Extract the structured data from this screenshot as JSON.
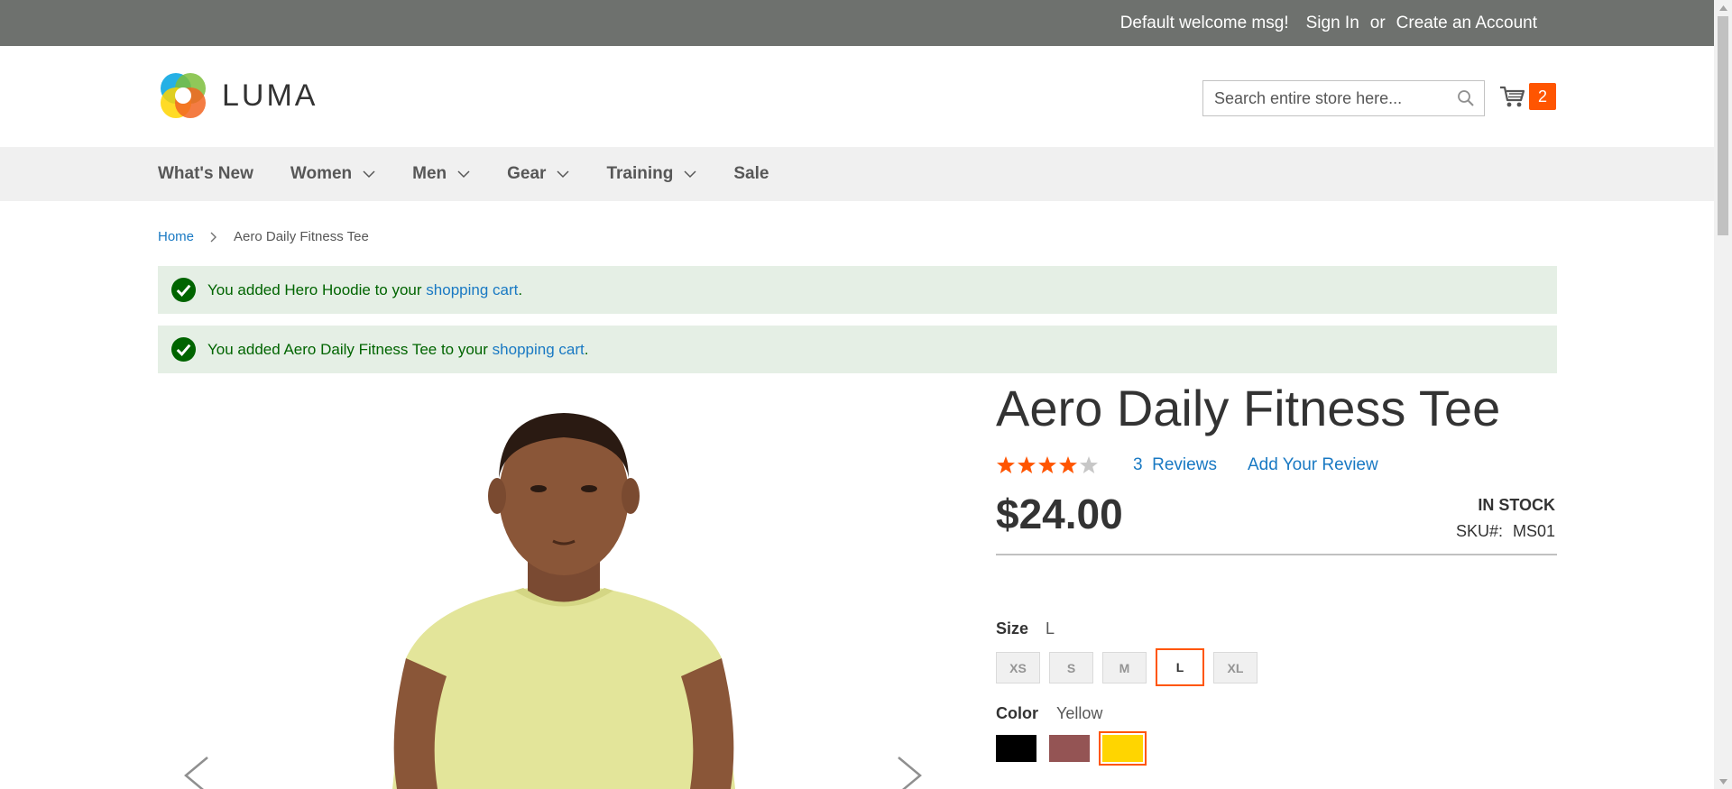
{
  "top_panel": {
    "welcome": "Default welcome msg!",
    "sign_in": "Sign In",
    "or": "or",
    "create_account": "Create an Account",
    "bg_color": "#6e716e"
  },
  "header": {
    "logo_text": "LUMA",
    "search_placeholder": "Search entire store here...",
    "cart_count": "2"
  },
  "nav": {
    "items": [
      {
        "label": "What's New",
        "has_dropdown": false
      },
      {
        "label": "Women",
        "has_dropdown": true
      },
      {
        "label": "Men",
        "has_dropdown": true
      },
      {
        "label": "Gear",
        "has_dropdown": true
      },
      {
        "label": "Training",
        "has_dropdown": true
      },
      {
        "label": "Sale",
        "has_dropdown": false
      }
    ]
  },
  "breadcrumb": {
    "home": "Home",
    "current": "Aero Daily Fitness Tee"
  },
  "messages": [
    {
      "prefix": "You added Hero Hoodie to your ",
      "link": "shopping cart",
      "suffix": "."
    },
    {
      "prefix": "You added Aero Daily Fitness Tee to your ",
      "link": "shopping cart",
      "suffix": "."
    }
  ],
  "product": {
    "title": "Aero Daily Fitness Tee",
    "rating_stars": 4,
    "rating_max": 5,
    "reviews_count": "3",
    "reviews_label": "Reviews",
    "add_review": "Add Your Review",
    "price": "$24.00",
    "stock": "IN STOCK",
    "sku_label": "SKU#:",
    "sku": "MS01",
    "size_label": "Size",
    "size_selected": "L",
    "sizes": [
      "XS",
      "S",
      "M",
      "L",
      "XL"
    ],
    "color_label": "Color",
    "color_selected": "Yellow",
    "colors": [
      {
        "name": "Black",
        "hex": "#000000"
      },
      {
        "name": "Brown",
        "hex": "#945454"
      },
      {
        "name": "Yellow",
        "hex": "#ffd500"
      }
    ]
  },
  "colors": {
    "accent": "#ff5501",
    "link": "#1979c3",
    "success_bg": "#e5efe5",
    "success_text": "#006400"
  }
}
